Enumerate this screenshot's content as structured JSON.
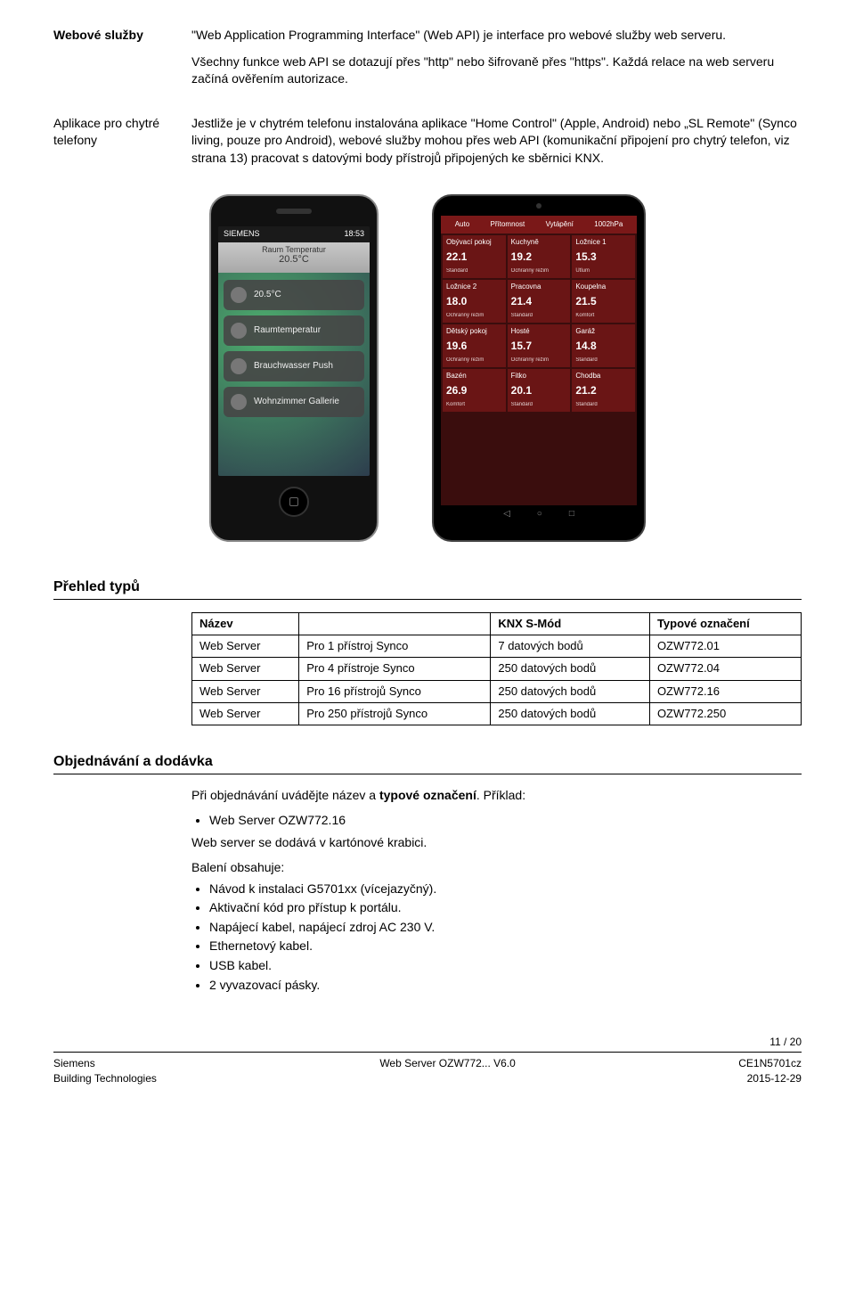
{
  "section1": {
    "label": "Webové služby",
    "para1": "\"Web Application Programming Interface\" (Web API) je interface pro webové služby web serveru.",
    "para2": "Všechny funkce web API se dotazují přes \"http\" nebo šifrovaně přes \"https\". Každá relace na web serveru začíná ověřením autorizace."
  },
  "section2": {
    "label": "Aplikace pro chytré telefony",
    "para": "Jestliže je v chytrém telefonu instalována aplikace \"Home Control\" (Apple, Android) nebo „SL Remote\" (Synco living, pouze pro Android), webové služby mohou přes web API (komunikační připojení pro chytrý telefon, viz strana 13) pracovat s datovými body přístrojů připojených ke sběrnici KNX."
  },
  "iphone": {
    "brand": "SIEMENS",
    "time": "18:53",
    "title_line1": "Raum Temperatur",
    "title_line2": "20.5°C",
    "items": [
      "20.5°C",
      "Raumtemperatur",
      "Brauchwasser Push",
      "Wohnzimmer Gallerie"
    ]
  },
  "tablet": {
    "hdr": [
      "Auto",
      "Přítomnost",
      "Vytápění",
      "1002hPa"
    ],
    "cells": [
      {
        "rm": "Obývací pokoj",
        "tmp": "22.1",
        "mode": "Standard"
      },
      {
        "rm": "Kuchyně",
        "tmp": "19.2",
        "mode": "Ochranný režim"
      },
      {
        "rm": "Ložnice 1",
        "tmp": "15.3",
        "mode": "Útlum"
      },
      {
        "rm": "Ložnice 2",
        "tmp": "18.0",
        "mode": "Ochranný režim"
      },
      {
        "rm": "Pracovna",
        "tmp": "21.4",
        "mode": "Standard"
      },
      {
        "rm": "Koupelna",
        "tmp": "21.5",
        "mode": "Komfort"
      },
      {
        "rm": "Dětský pokoj",
        "tmp": "19.6",
        "mode": "Ochranný režim"
      },
      {
        "rm": "Hosté",
        "tmp": "15.7",
        "mode": "Ochranný režim"
      },
      {
        "rm": "Garáž",
        "tmp": "14.8",
        "mode": "Standard"
      },
      {
        "rm": "Bazén",
        "tmp": "26.9",
        "mode": "Komfort"
      },
      {
        "rm": "Fitko",
        "tmp": "20.1",
        "mode": "Standard"
      },
      {
        "rm": "Chodba",
        "tmp": "21.2",
        "mode": "Standard"
      }
    ],
    "nav": [
      "◁",
      "○",
      "□"
    ]
  },
  "types": {
    "heading": "Přehled typů",
    "headers": [
      "Název",
      "",
      "KNX S-Mód",
      "Typové označení"
    ],
    "rows": [
      [
        "Web Server",
        "Pro 1 přístroj Synco",
        "7 datových bodů",
        "OZW772.01"
      ],
      [
        "Web Server",
        "Pro 4 přístroje Synco",
        "250 datových bodů",
        "OZW772.04"
      ],
      [
        "Web Server",
        "Pro 16 přístrojů Synco",
        "250 datových bodů",
        "OZW772.16"
      ],
      [
        "Web Server",
        "Pro 250 přístrojů Synco",
        "250 datových bodů",
        "OZW772.250"
      ]
    ]
  },
  "ordering": {
    "heading": "Objednávání a dodávka",
    "para1a": "Při objednávání uvádějte název a ",
    "para1b": "typové označení",
    "para1c": ". Příklad:",
    "example": "Web Server  OZW772.16",
    "para2": "Web server se dodává v kartónové krabici.",
    "para3": "Balení obsahuje:",
    "bullets": [
      "Návod k instalaci G5701xx (vícejazyčný).",
      "Aktivační kód pro přístup k portálu.",
      "Napájecí kabel, napájecí zdroj AC 230 V.",
      "Ethernetový kabel.",
      "USB kabel.",
      "2 vyvazovací pásky."
    ]
  },
  "footer": {
    "pageno": "11 / 20",
    "left1": "Siemens",
    "left2": "Building Technologies",
    "center": "Web Server OZW772... V6.0",
    "right1": "CE1N5701cz",
    "right2": "2015-12-29"
  }
}
